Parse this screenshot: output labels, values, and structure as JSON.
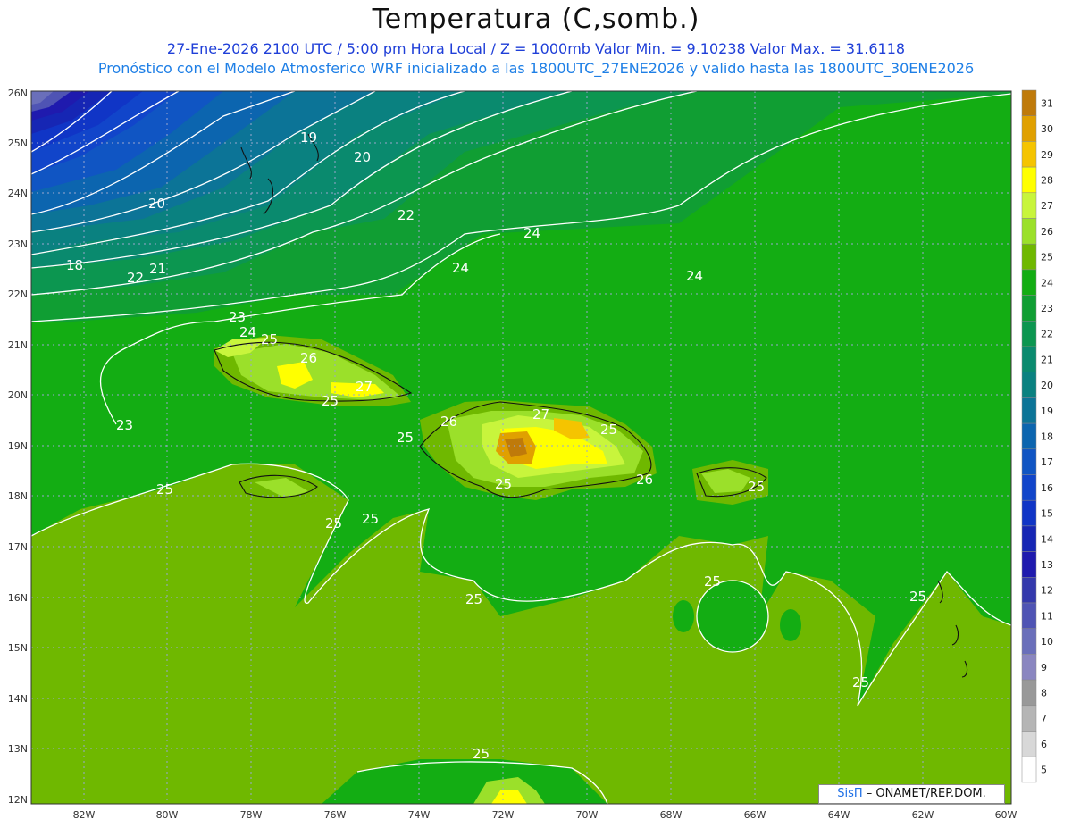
{
  "header": {
    "title": "Temperatura (C,somb.)",
    "subtitle1": "27-Ene-2026  2100 UTC / 5:00 pm Hora Local / Z = 1000mb   Valor Min. = 9.10238  Valor Max. = 31.6118",
    "subtitle2": "Pronóstico con el Modelo Atmosferico WRF inicializado a las 1800UTC_27ENE2026 y valido hasta las  1800UTC_30ENE2026"
  },
  "map": {
    "lat_ticks": [
      "26N",
      "25N",
      "24N",
      "23N",
      "22N",
      "21N",
      "20N",
      "19N",
      "18N",
      "17N",
      "16N",
      "15N",
      "14N",
      "13N",
      "12N"
    ],
    "lon_ticks": [
      "82W",
      "80W",
      "78W",
      "76W",
      "74W",
      "72W",
      "70W",
      "68W",
      "66W",
      "64W",
      "62W",
      "60W"
    ],
    "contour_labels": [
      {
        "text": "19"
      },
      {
        "text": "20"
      },
      {
        "text": "20"
      },
      {
        "text": "22"
      },
      {
        "text": "24"
      },
      {
        "text": "24"
      },
      {
        "text": "24"
      },
      {
        "text": "18"
      },
      {
        "text": "22"
      },
      {
        "text": "21"
      },
      {
        "text": "23"
      },
      {
        "text": "24"
      },
      {
        "text": "25"
      },
      {
        "text": "26"
      },
      {
        "text": "27"
      },
      {
        "text": "25"
      },
      {
        "text": "25"
      },
      {
        "text": "23"
      },
      {
        "text": "25"
      },
      {
        "text": "25"
      },
      {
        "text": "25"
      },
      {
        "text": "26"
      },
      {
        "text": "27"
      },
      {
        "text": "25"
      },
      {
        "text": "25"
      },
      {
        "text": "26"
      },
      {
        "text": "25"
      },
      {
        "text": "25"
      },
      {
        "text": "25"
      },
      {
        "text": "25"
      },
      {
        "text": "25"
      },
      {
        "text": "25"
      }
    ]
  },
  "legend": {
    "labels": [
      "31",
      "30",
      "29",
      "28",
      "27",
      "26",
      "25",
      "24",
      "23",
      "22",
      "21",
      "20",
      "19",
      "18",
      "17",
      "16",
      "15",
      "14",
      "13",
      "12",
      "11",
      "10",
      "9",
      "8",
      "7",
      "6",
      "5"
    ],
    "colors": [
      "#bf7a0a",
      "#e0a000",
      "#f5c400",
      "#ffff00",
      "#c8f53c",
      "#9be02a",
      "#6fb800",
      "#13ad13",
      "#109e33",
      "#0c9650",
      "#0a8a6e",
      "#0a8180",
      "#0c7497",
      "#0c65af",
      "#1055c3",
      "#1145ca",
      "#1035c6",
      "#1626b4",
      "#1f1aae",
      "#3439ac",
      "#4f54b4",
      "#6a6fba",
      "#8a86c0",
      "#999999",
      "#b5b5b5",
      "#d8d8d8",
      "#ffffff"
    ]
  },
  "credit": {
    "brand": "SisΠ",
    "text": " – ONAMET/REP.DOM."
  }
}
